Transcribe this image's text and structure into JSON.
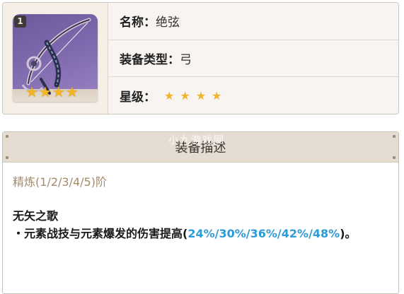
{
  "weapon": {
    "refine_badge": "1",
    "name_label": "名称：",
    "name_value": "绝弦",
    "type_label": "装备类型：",
    "type_value": "弓",
    "rarity_label": "星级：",
    "rarity_stars": 4,
    "card_stars": 4
  },
  "description": {
    "header": "装备描述",
    "watermark": "小九游戏网",
    "refine_text": "精炼(1/2/3/4/5)阶",
    "passive_title": "无矢之歌",
    "bullet": "・",
    "passive_prefix": "元素战技与元素爆发的伤害提高(",
    "passive_values": "24%/30%/36%/42%/48%",
    "passive_suffix": ")。"
  },
  "colors": {
    "highlight": "#2e9bd6",
    "star": "#f0b42a",
    "refine_text": "#a38b6b",
    "header_bg": "#e5ddd2"
  },
  "icons": {
    "weapon": "bow-icon",
    "star": "star-icon"
  }
}
